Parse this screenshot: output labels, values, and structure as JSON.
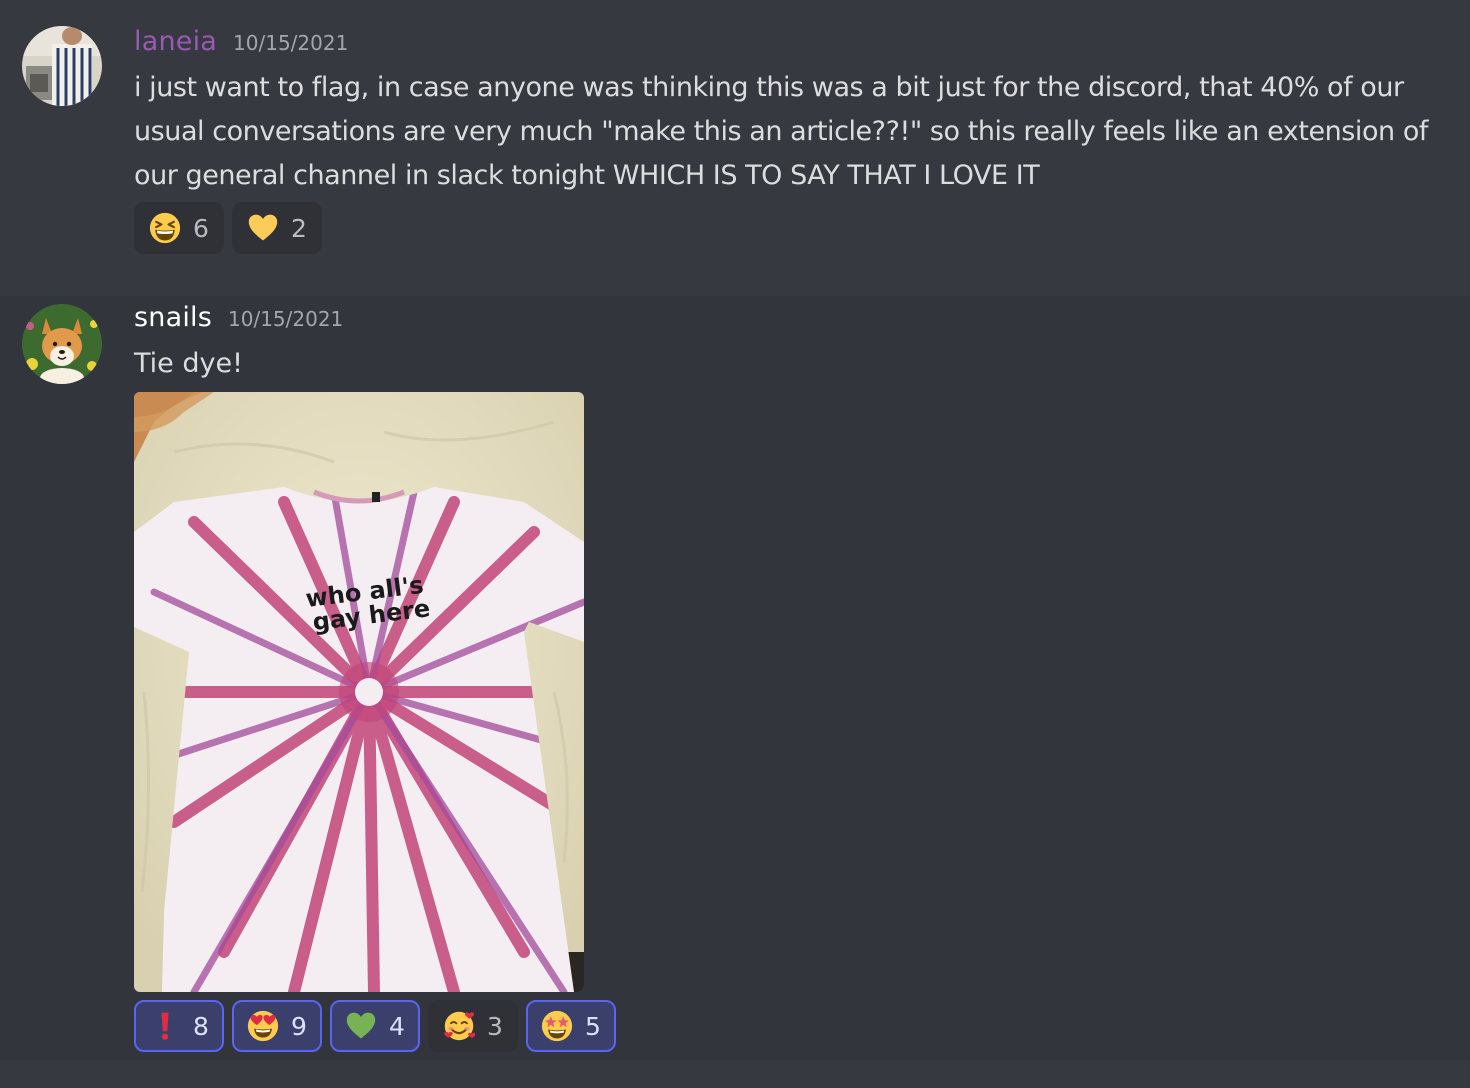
{
  "messages": [
    {
      "author": "laneia",
      "timestamp": "10/15/2021",
      "text": "i just want to flag, in case anyone was thinking this was a bit just for the discord, that 40% of our usual conversations are very much \"make this an article??!\" so this really feels like an extension of our general channel in slack tonight WHICH IS TO SAY THAT I LOVE IT",
      "reactions": [
        {
          "emoji": "laughing-emoji",
          "count": "6",
          "mine": false
        },
        {
          "emoji": "yellow-heart-emoji",
          "count": "2",
          "mine": false
        }
      ]
    },
    {
      "author": "snails",
      "timestamp": "10/15/2021",
      "text": "Tie dye!",
      "attachment": {
        "kind": "photo",
        "shirt_text_line1": "who all's",
        "shirt_text_line2": "gay here"
      },
      "reactions": [
        {
          "emoji": "exclamation-emoji",
          "count": "8",
          "mine": true
        },
        {
          "emoji": "heart-eyes-emoji",
          "count": "9",
          "mine": true
        },
        {
          "emoji": "green-heart-emoji",
          "count": "4",
          "mine": true
        },
        {
          "emoji": "smiling-face-with-hearts-emoji",
          "count": "3",
          "mine": false
        },
        {
          "emoji": "star-struck-emoji",
          "count": "5",
          "mine": true
        }
      ]
    }
  ],
  "colors": {
    "background": "#36393f",
    "hover_background": "#32353b",
    "laneia_name": "#9b59b6",
    "reaction_active_border": "#5865f2"
  }
}
